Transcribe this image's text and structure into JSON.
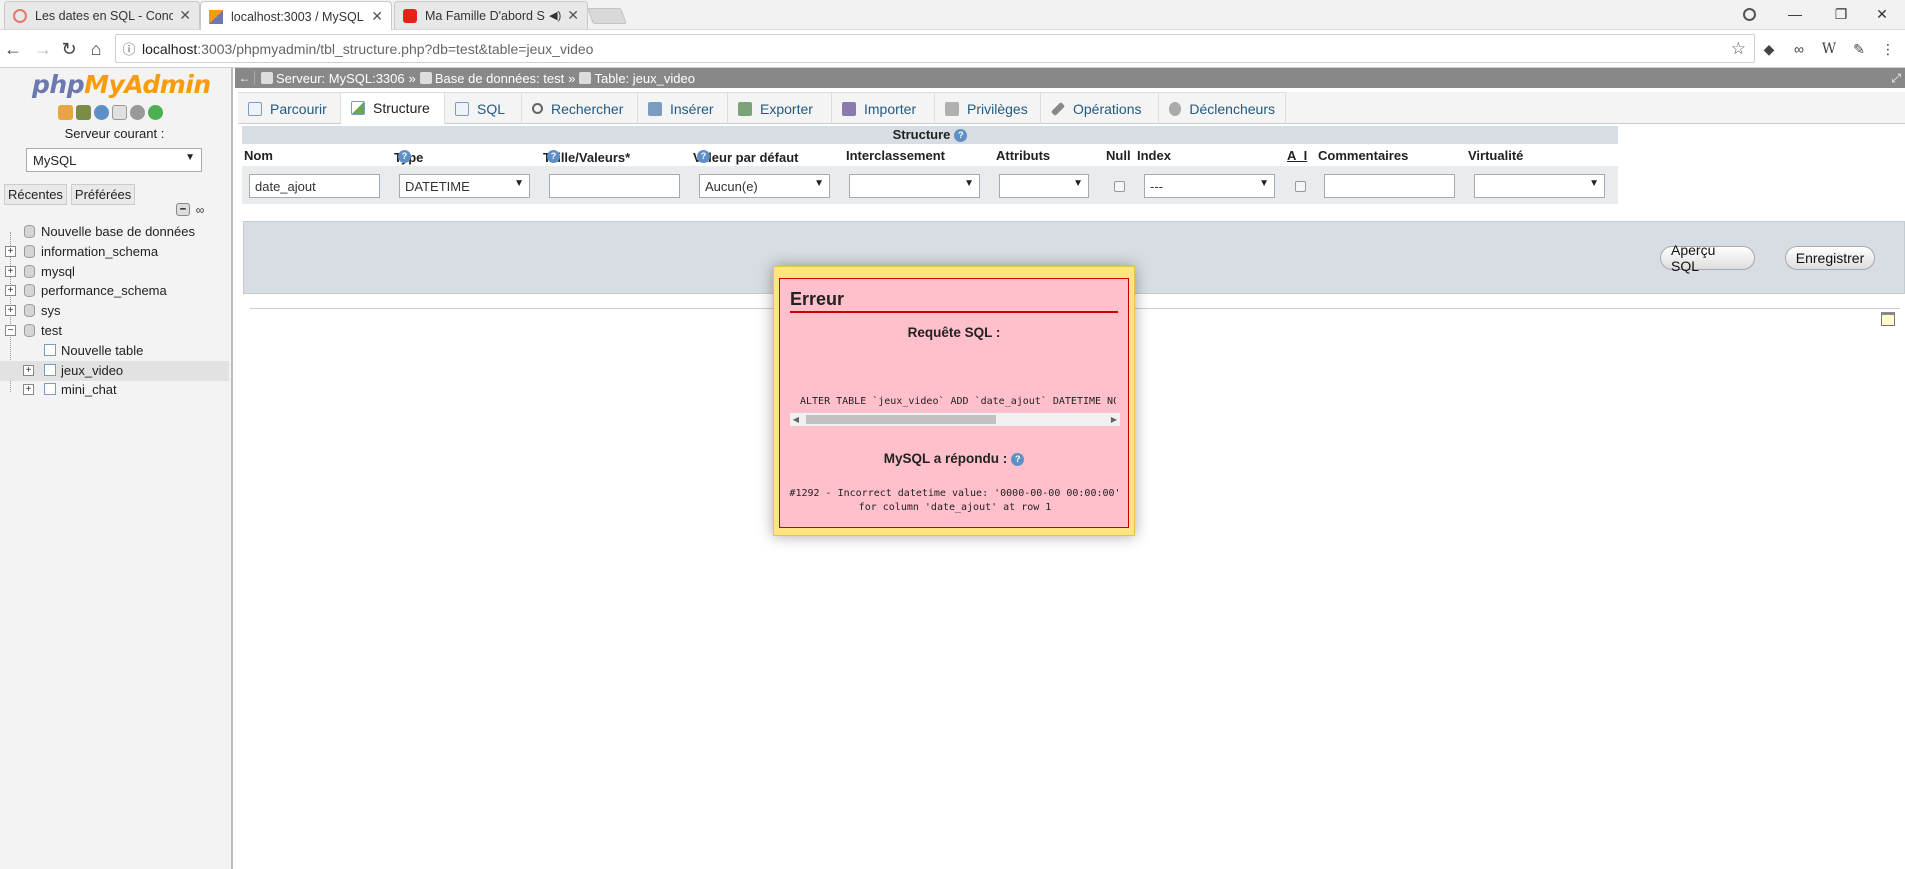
{
  "browser": {
    "tabs": [
      {
        "title": "Les dates en SQL - Conc",
        "close": "✕"
      },
      {
        "title": "localhost:3003 / MySQL /",
        "close": "✕"
      },
      {
        "title": "Ma Famille D'abord S",
        "close": "✕"
      }
    ],
    "url_host": "localhost",
    "url_rest": ":3003/phpmyadmin/tbl_structure.php?db=test&table=jeux_video",
    "star": "☆"
  },
  "sidebar": {
    "logo_php": "php",
    "logo_myadmin": "MyAdmin",
    "server_label": "Serveur courant :",
    "server_select": "MySQL",
    "recent_tab": "Récentes",
    "favorites_tab": "Préférées",
    "tree": {
      "new_db": "Nouvelle base de données",
      "databases": [
        "information_schema",
        "mysql",
        "performance_schema",
        "sys",
        "test"
      ],
      "new_table": "Nouvelle table",
      "tables": [
        "jeux_video",
        "mini_chat"
      ]
    }
  },
  "breadcrumb": {
    "server": "Serveur: MySQL:3306",
    "database": "Base de données: test",
    "table": "Table: jeux_video",
    "sep": "»"
  },
  "menu": {
    "tabs": [
      "Parcourir",
      "Structure",
      "SQL",
      "Rechercher",
      "Insérer",
      "Exporter",
      "Importer",
      "Privilèges",
      "Opérations",
      "Déclencheurs"
    ],
    "active": "Structure"
  },
  "structure": {
    "heading": "Structure",
    "help": "?",
    "columns": {
      "nom": "Nom",
      "type": "Type",
      "taille": "Taille/Valeurs*",
      "defaut": "Valeur par défaut",
      "interclassement": "Interclassement",
      "attributs": "Attributs",
      "null": "Null",
      "index": "Index",
      "ai": "A_I",
      "commentaires": "Commentaires",
      "virtualite": "Virtualité"
    },
    "row": {
      "nom": "date_ajout",
      "type": "DATETIME",
      "taille": "",
      "defaut": "Aucun(e)",
      "interclassement": "",
      "attributs": "",
      "index": "---",
      "commentaires": "",
      "virtualite": ""
    }
  },
  "actions": {
    "preview": "Aperçu SQL",
    "save": "Enregistrer"
  },
  "error": {
    "title": "Erreur",
    "query_label": "Requête SQL :",
    "query": "ALTER TABLE `jeux_video`  ADD `date_ajout` DATETIME NOT NULL",
    "response_label": "MySQL a répondu :",
    "message_line1": "#1292 - Incorrect datetime value: '0000-00-00 00:00:00'",
    "message_line2": "for column 'date_ajout' at row 1"
  },
  "colors": {
    "accent": "#235a81",
    "error_bg": "#ffc0cb",
    "error_border": "#cc0000",
    "overlay_bg": "#ffe57f"
  }
}
